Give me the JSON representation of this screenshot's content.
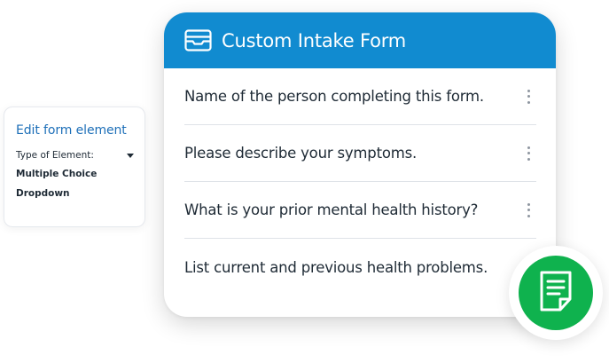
{
  "edit_panel": {
    "title": "Edit form element",
    "type_label": "Type of Element:",
    "options": [
      "Multiple Choice",
      "Dropdown"
    ]
  },
  "form": {
    "title": "Custom Intake Form",
    "header_icon": "inbox-icon",
    "questions": [
      "Name of the person completing this form.",
      "Please describe your symptoms.",
      "What is your prior mental health history?",
      "List current and previous health problems."
    ]
  },
  "colors": {
    "header": "#118bd0",
    "link_title": "#1d6fb8",
    "fab": "#0fb24e"
  },
  "fab_icon": "document-icon"
}
